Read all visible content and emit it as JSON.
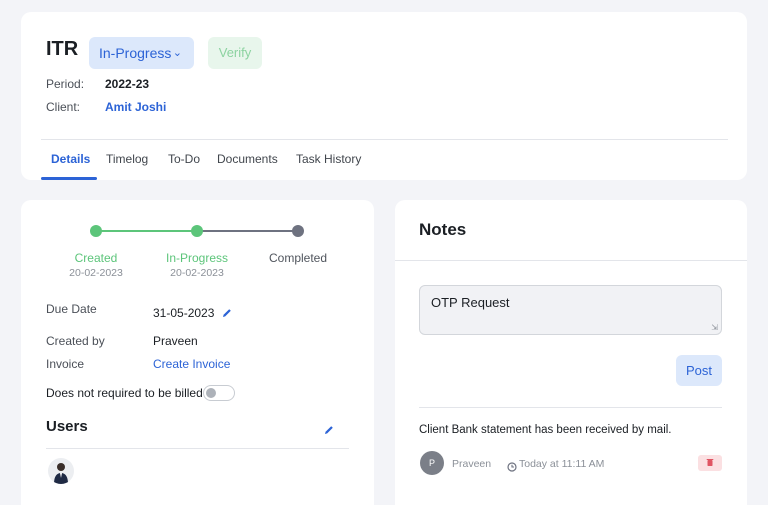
{
  "task": {
    "title": "ITR",
    "status_label": "In-Progress",
    "verify_label": "Verify",
    "period_label": "Period:",
    "period_value": "2022-23",
    "client_label": "Client:",
    "client_value": "Amit Joshi"
  },
  "tabs": [
    {
      "label": "Details",
      "active": true
    },
    {
      "label": "Timelog"
    },
    {
      "label": "To-Do"
    },
    {
      "label": "Documents"
    },
    {
      "label": "Task History"
    }
  ],
  "progress": {
    "steps": [
      {
        "label": "Created",
        "date": "20-02-2023",
        "state": "done"
      },
      {
        "label": "In-Progress",
        "date": "20-02-2023",
        "state": "done"
      },
      {
        "label": "Completed",
        "date": "",
        "state": "pending"
      }
    ],
    "done_color": "#5cc57a",
    "pending_color": "#6e7280"
  },
  "details": {
    "due_date_label": "Due Date",
    "due_date_value": "31-05-2023",
    "created_by_label": "Created by",
    "created_by_value": "Praveen",
    "invoice_label": "Invoice",
    "invoice_value": "Create Invoice",
    "billing_label": "Does not required to be billed",
    "billing_toggle_on": false
  },
  "users": {
    "heading": "Users"
  },
  "notes": {
    "heading": "Notes",
    "input_value": "OTP Request",
    "post_label": "Post",
    "items": [
      {
        "text": "Client Bank statement has been received by mail.",
        "author_initial": "P",
        "author": "Praveen",
        "time": "Today at 11:11 AM"
      }
    ]
  },
  "colors": {
    "accent": "#2c63d6",
    "success": "#5cc57a",
    "danger": "#e05563"
  }
}
